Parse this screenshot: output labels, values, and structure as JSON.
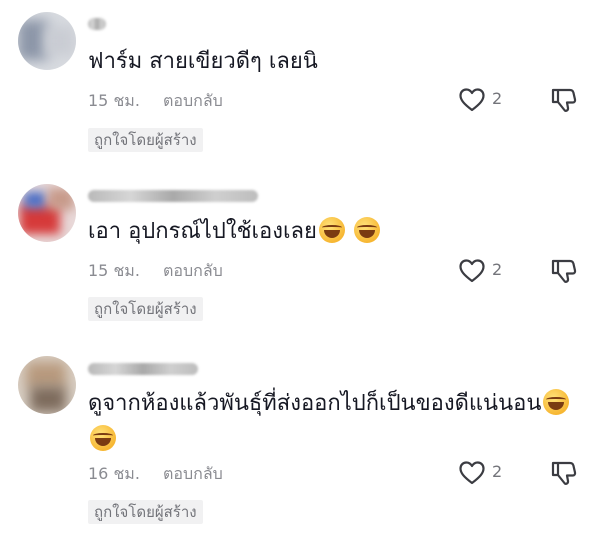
{
  "comments": [
    {
      "text": "ฟาร์ม สายเขียวดีๆ เลยนิ",
      "time": "15 ชม.",
      "reply": "ตอบกลับ",
      "likes": "2",
      "badge": "ถูกใจโดยผู้สร้าง"
    },
    {
      "text": "เอา อุปกรณ์ไปใช้เองเลย",
      "time": "15 ชม.",
      "reply": "ตอบกลับ",
      "likes": "2",
      "badge": "ถูกใจโดยผู้สร้าง"
    },
    {
      "text": "ดูจากห้องแล้วพันธุ์ที่ส่งออกไปก็เป็นของดีแน่นอน",
      "time": "16 ชม.",
      "reply": "ตอบกลับ",
      "likes": "2",
      "badge": "ถูกใจโดยผู้สร้าง"
    }
  ],
  "icons": {
    "like": "heart-outline-icon",
    "dislike": "thumbs-down-outline-icon",
    "emoji": "laughing-tears-emoji"
  },
  "colors": {
    "text": "#161823",
    "meta": "#8a8b91",
    "badge_bg": "#f1f1f2",
    "badge_text": "#73747a"
  }
}
